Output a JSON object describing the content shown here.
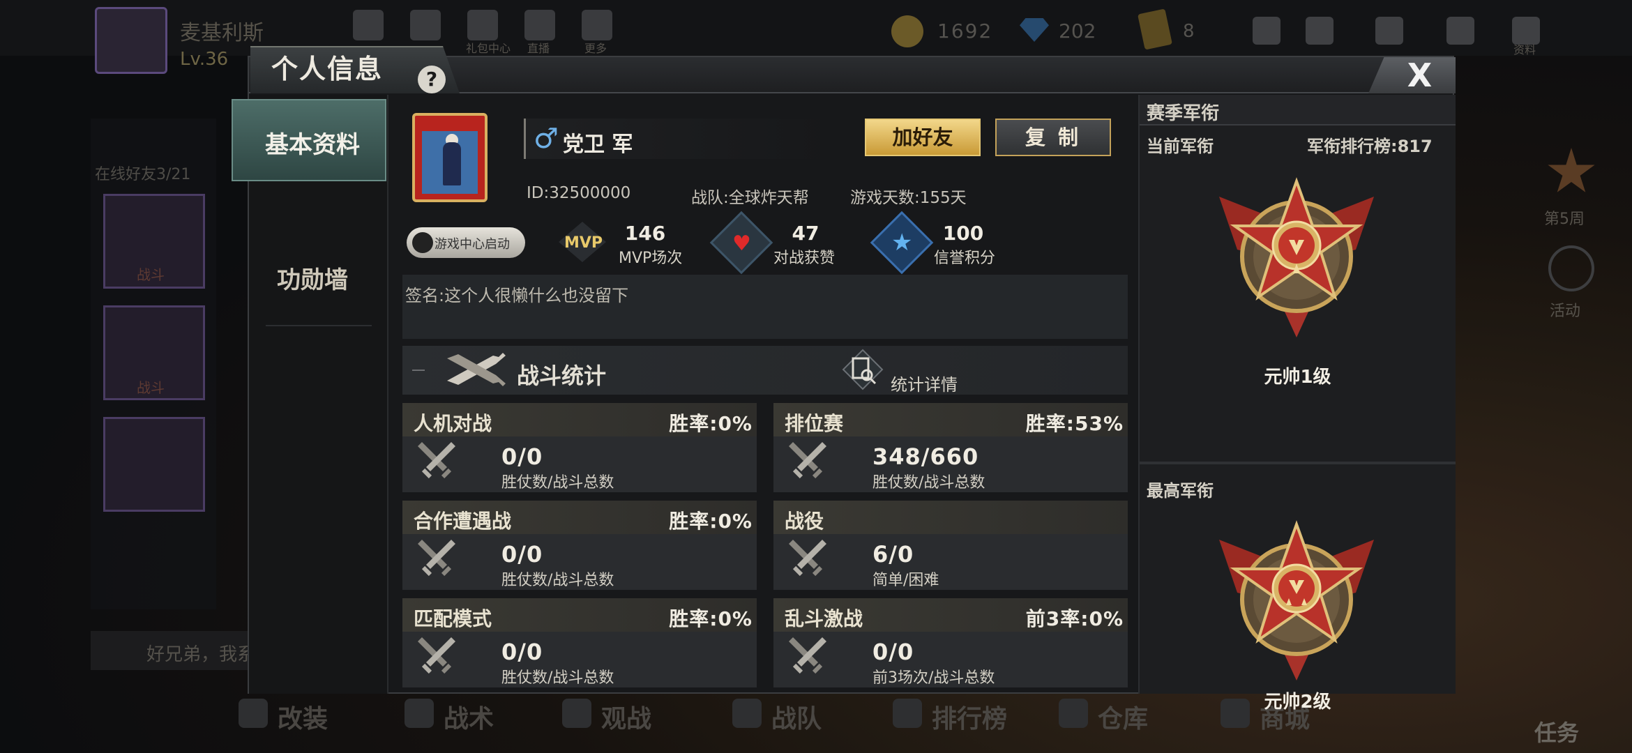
{
  "background": {
    "player_name": "麦基利斯",
    "level": "Lv.36",
    "nav_labels": [
      "礼包中心",
      "直播",
      "更多"
    ],
    "coins": "1692",
    "diamonds": "202",
    "cards": "8",
    "sidebar_label": "在线好友3/21",
    "frame_labels": [
      "战斗",
      "战斗"
    ],
    "chat_text": "好兄弟，我系",
    "bottom_nav": [
      "改装",
      "战术",
      "观战",
      "战队",
      "排行榜",
      "仓库",
      "商城"
    ],
    "right_labels": [
      "第5周",
      "活动"
    ],
    "task_label": "任务",
    "resource_label": "资料"
  },
  "modal": {
    "title": "个人信息",
    "help_label": "?",
    "close_label": "X"
  },
  "nav": {
    "active_tab": "基本资料",
    "tab2": "功勋墙"
  },
  "profile": {
    "gender_symbol": "♂",
    "name": "党卫 军",
    "add_friend_label": "加好友",
    "copy_label": "复 制",
    "id_text": "ID:32500000",
    "team_text": "战队:全球炸天帮",
    "days_text": "游戏天数:155天",
    "game_center_label": "游戏中心启动",
    "signature": "签名:这个人很懒什么也没留下"
  },
  "stats_summary": [
    {
      "icon": "mvp-icon",
      "badge": "MVP",
      "value": "146",
      "label": "MVP场次"
    },
    {
      "icon": "heart-icon",
      "value": "47",
      "label": "对战获赞"
    },
    {
      "icon": "star-icon",
      "value": "100",
      "label": "信誉积分"
    }
  ],
  "battle": {
    "section_title": "战斗统计",
    "detail_label": "统计详情",
    "cards": [
      {
        "title": "人机对战",
        "rate": "胜率:0%",
        "value": "0/0",
        "sub": "胜仗数/战斗总数"
      },
      {
        "title": "排位赛",
        "rate": "胜率:53%",
        "value": "348/660",
        "sub": "胜仗数/战斗总数"
      },
      {
        "title": "合作遭遇战",
        "rate": "胜率:0%",
        "value": "0/0",
        "sub": "胜仗数/战斗总数"
      },
      {
        "title": "战役",
        "rate": "",
        "value": "6/0",
        "sub": "简单/困难"
      },
      {
        "title": "匹配模式",
        "rate": "胜率:0%",
        "value": "0/0",
        "sub": "胜仗数/战斗总数"
      },
      {
        "title": "乱斗激战",
        "rate": "前3率:0%",
        "value": "0/0",
        "sub": "前3场次/战斗总数"
      }
    ]
  },
  "rank": {
    "header": "赛季军衔",
    "current_label": "当前军衔",
    "ranking_text": "军衔排行榜:817",
    "current_name": "元帅1级",
    "highest_label": "最高军衔",
    "highest_name": "元帅2级"
  },
  "colors": {
    "accent_gold": "#d9b060",
    "teal_tab": "#3d5a56",
    "medal_red": "#b8322a"
  }
}
